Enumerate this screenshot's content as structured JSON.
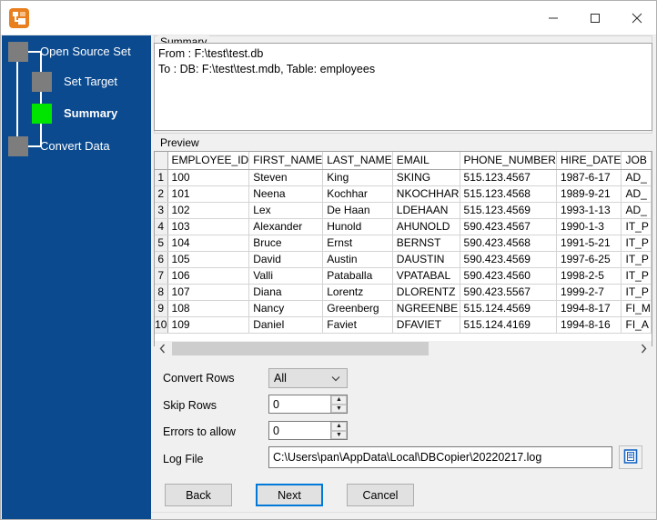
{
  "window": {
    "title": "",
    "app_icon": "dbcopier-icon",
    "minimize_label": "Minimize",
    "maximize_label": "Maximize",
    "close_label": "Close"
  },
  "sidebar": {
    "steps": [
      {
        "label": "Open Source Set",
        "state": "pending"
      },
      {
        "label": "Set Target",
        "state": "pending"
      },
      {
        "label": "Summary",
        "state": "active"
      },
      {
        "label": "Convert Data",
        "state": "pending"
      }
    ],
    "colors": {
      "background": "#0b4a8f",
      "node": "#7d7d7d",
      "active_node": "#00e500",
      "text": "#ffffff"
    }
  },
  "summary": {
    "caption": "Summary",
    "lines": [
      "From : F:\\test\\test.db",
      "To : DB: F:\\test\\test.mdb, Table: employees"
    ]
  },
  "preview": {
    "caption": "Preview",
    "columns": [
      "EMPLOYEE_ID",
      "FIRST_NAME",
      "LAST_NAME",
      "EMAIL",
      "PHONE_NUMBER",
      "HIRE_DATE",
      "JOB"
    ],
    "row_numbers": [
      "1",
      "2",
      "3",
      "4",
      "5",
      "6",
      "7",
      "8",
      "9",
      "10"
    ],
    "rows": [
      [
        "100",
        "Steven",
        "King",
        "SKING",
        "515.123.4567",
        "1987-6-17",
        "AD_"
      ],
      [
        "101",
        "Neena",
        "Kochhar",
        "NKOCHHAR",
        "515.123.4568",
        "1989-9-21",
        "AD_"
      ],
      [
        "102",
        "Lex",
        "De Haan",
        "LDEHAAN",
        "515.123.4569",
        "1993-1-13",
        "AD_"
      ],
      [
        "103",
        "Alexander",
        "Hunold",
        "AHUNOLD",
        "590.423.4567",
        "1990-1-3",
        "IT_P"
      ],
      [
        "104",
        "Bruce",
        "Ernst",
        "BERNST",
        "590.423.4568",
        "1991-5-21",
        "IT_P"
      ],
      [
        "105",
        "David",
        "Austin",
        "DAUSTIN",
        "590.423.4569",
        "1997-6-25",
        "IT_P"
      ],
      [
        "106",
        "Valli",
        "Pataballa",
        "VPATABAL",
        "590.423.4560",
        "1998-2-5",
        "IT_P"
      ],
      [
        "107",
        "Diana",
        "Lorentz",
        "DLORENTZ",
        "590.423.5567",
        "1999-2-7",
        "IT_P"
      ],
      [
        "108",
        "Nancy",
        "Greenberg",
        "NGREENBE",
        "515.124.4569",
        "1994-8-17",
        "FI_M"
      ],
      [
        "109",
        "Daniel",
        "Faviet",
        "DFAVIET",
        "515.124.4169",
        "1994-8-16",
        "FI_A"
      ]
    ],
    "scroll_left_icon": "chevron-left-icon",
    "scroll_right_icon": "chevron-right-icon"
  },
  "form": {
    "convert_rows": {
      "label": "Convert Rows",
      "value": "All",
      "chevron": "chevron-down-icon"
    },
    "skip_rows": {
      "label": "Skip Rows",
      "value": "0",
      "up": "spinner-up-icon",
      "down": "spinner-down-icon"
    },
    "errors_to_allow": {
      "label": "Errors to allow",
      "value": "0",
      "up": "spinner-up-icon",
      "down": "spinner-down-icon"
    },
    "log_file": {
      "label": "Log File",
      "value": "C:\\Users\\pan\\AppData\\Local\\DBCopier\\20220217.log",
      "browse_icon": "file-browse-icon"
    }
  },
  "footer": {
    "back_label": "Back",
    "next_label": "Next",
    "cancel_label": "Cancel",
    "default_button": "Next",
    "focus_color": "#0078d7"
  }
}
